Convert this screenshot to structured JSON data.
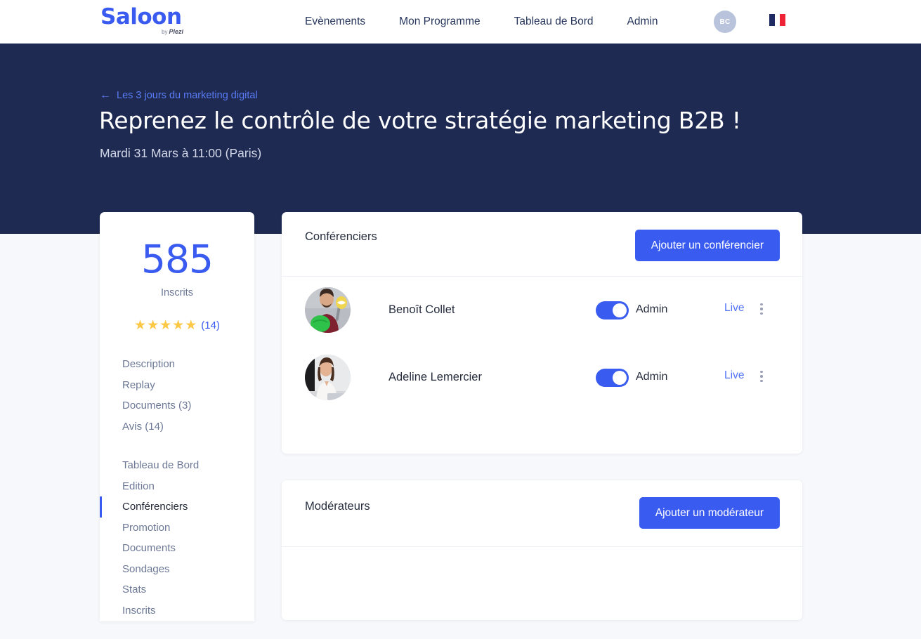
{
  "nav": {
    "logo": {
      "text": "Saloon",
      "by_label": "by",
      "brand": "Plezi"
    },
    "links": [
      {
        "label": "Evènements"
      },
      {
        "label": "Mon Programme"
      },
      {
        "label": "Tableau de Bord"
      },
      {
        "label": "Admin"
      }
    ],
    "avatar_initials": "BC",
    "language_flag": "france-flag"
  },
  "hero": {
    "breadcrumb_arrow": "←",
    "breadcrumb": "Les 3 jours du marketing digital",
    "title": "Reprenez le contrôle de votre stratégie marketing B2B !",
    "date": "Mardi 31 Mars à 11:00 (Paris)"
  },
  "sidebar": {
    "stat_number": "585",
    "stat_label": "Inscrits",
    "stars": [
      "★",
      "★",
      "★",
      "★",
      "★"
    ],
    "rating_count": "(14)",
    "group1": [
      {
        "label": "Description",
        "active": false
      },
      {
        "label": "Replay",
        "active": false
      },
      {
        "label": "Documents (3)",
        "active": false
      },
      {
        "label": "Avis (14)",
        "active": false
      }
    ],
    "group2": [
      {
        "label": "Tableau de Bord",
        "active": false
      },
      {
        "label": "Edition",
        "active": false
      },
      {
        "label": "Conférenciers",
        "active": true
      },
      {
        "label": "Promotion",
        "active": false
      },
      {
        "label": "Documents",
        "active": false
      },
      {
        "label": "Sondages",
        "active": false
      },
      {
        "label": "Stats",
        "active": false
      },
      {
        "label": "Inscrits",
        "active": false
      }
    ]
  },
  "speakers_card": {
    "title": "Conférenciers",
    "add_button": "Ajouter un conférencier",
    "rows": [
      {
        "name": "Benoît Collet",
        "role_label": "Admin",
        "toggle_on": true,
        "live_label": "Live",
        "menu_icon": "kebab-menu-icon"
      },
      {
        "name": "Adeline Lemercier",
        "role_label": "Admin",
        "toggle_on": true,
        "live_label": "Live",
        "menu_icon": "kebab-menu-icon"
      }
    ]
  },
  "moderators_card": {
    "title": "Modérateurs",
    "add_button": "Ajouter un modérateur",
    "rows": []
  },
  "colors": {
    "brand_blue": "#3a5bf0",
    "hero_navy": "#1e2a52",
    "page_bg": "#f7f8fb",
    "star_gold": "#fcc845",
    "muted_text": "#6c7896"
  }
}
